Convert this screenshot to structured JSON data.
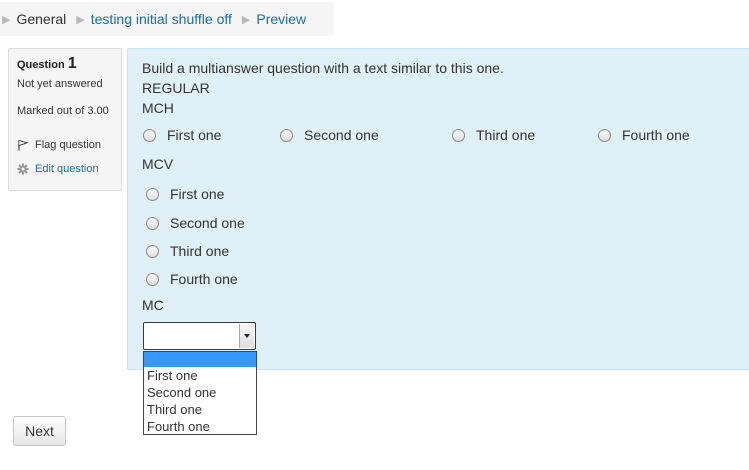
{
  "breadcrumb": {
    "items": [
      "General",
      "testing initial shuffle off",
      "Preview"
    ]
  },
  "info": {
    "question_label": "Question",
    "question_number": "1",
    "state": "Not yet answered",
    "mark": "Marked out of 3.00",
    "flag": "Flag question",
    "edit": "Edit question"
  },
  "content": {
    "intro": "Build a multianswer question with a text similar to this one.",
    "regular": "REGULAR",
    "mch_label": "MCH",
    "mch_options": [
      "First one",
      "Second one",
      "Third one",
      "Fourth one"
    ],
    "mcv_label": "MCV",
    "mcv_options": [
      "First one",
      "Second one",
      "Third one",
      "Fourth one"
    ],
    "mc_label": "MC",
    "mc_selected": "",
    "mc_options": [
      "",
      "First one",
      "Second one",
      "Third one",
      "Fourth one"
    ]
  },
  "next_label": "Next",
  "colors": {
    "link": "#1a6fa0",
    "content_bg": "#dff0f6",
    "selected_option": "#3399ff"
  },
  "icons": {
    "flag": "flag-icon",
    "edit": "gear-icon",
    "separator": "triangle-right-icon",
    "dropdown": "chevron-down-icon"
  }
}
